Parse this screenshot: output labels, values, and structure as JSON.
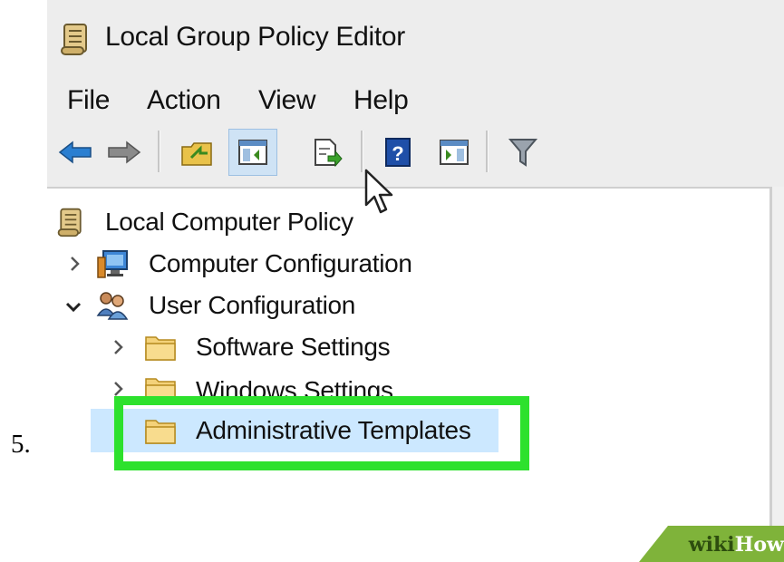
{
  "step": {
    "number": "5."
  },
  "window": {
    "title": "Local Group Policy Editor",
    "title_icon": "scroll-policy-icon"
  },
  "menu": {
    "items": [
      "File",
      "Action",
      "View",
      "Help"
    ]
  },
  "toolbar": {
    "buttons": [
      {
        "icon": "back-arrow-icon",
        "pressed": false
      },
      {
        "icon": "forward-arrow-icon",
        "pressed": false
      },
      {
        "icon": "up-folder-icon",
        "pressed": false
      },
      {
        "icon": "show-hide-console-tree-icon",
        "pressed": true
      },
      {
        "icon": "export-list-icon",
        "pressed": false
      },
      {
        "icon": "help-icon",
        "pressed": false
      },
      {
        "icon": "show-hide-action-pane-icon",
        "pressed": false
      },
      {
        "icon": "filter-icon",
        "pressed": false
      }
    ]
  },
  "tree": {
    "root": {
      "label": "Local Computer Policy",
      "icon": "scroll-policy-icon"
    },
    "computer_config": {
      "label": "Computer Configuration",
      "icon": "computer-icon",
      "expanded": false
    },
    "user_config": {
      "label": "User Configuration",
      "icon": "users-icon",
      "expanded": true
    },
    "software_settings": {
      "label": "Software Settings",
      "icon": "folder-icon"
    },
    "windows_settings": {
      "label": "Windows Settings",
      "icon": "folder-icon"
    },
    "admin_templates": {
      "label": "Administrative Templates",
      "icon": "folder-icon",
      "selected": true
    }
  },
  "colors": {
    "highlight": "#2de12d",
    "selection": "#cce8ff",
    "watermark": "#7fb33a"
  },
  "watermark": {
    "part1": "wiki",
    "part2": "How"
  }
}
